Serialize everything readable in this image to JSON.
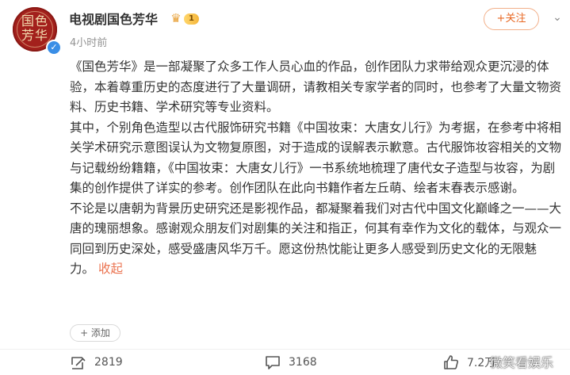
{
  "account": {
    "name": "电视剧国色芳华",
    "avatar_text": "国色芳华",
    "level": "1",
    "verified_icon": "verified-icon",
    "timestamp": "4小时前",
    "follow_label": "+关注"
  },
  "post": {
    "paragraphs": [
      "《国色芳华》是一部凝聚了众多工作人员心血的作品，创作团队力求带给观众更沉浸的体验，本着尊重历史的态度进行了大量调研，请教相关专家学者的同时，也参考了大量文物资料、历史书籍、学术研究等专业资料。",
      "其中，个别角色造型以古代服饰研究书籍《中国妆束：大唐女儿行》为考据，在参考中将相关学术研究示意图误认为文物复原图，对于造成的误解表示歉意。古代服饰妆容相关的文物与记载纷纷籍籍，《中国妆束：大唐女儿行》一书系统地梳理了唐代女子造型与妆容，为剧集的创作提供了详实的参考。创作团队在此向书籍作者左丘萌、绘者末春表示感谢。"
    ],
    "last_paragraph": "不论是以唐朝为背景历史研究还是影视作品，都凝聚着我们对古代中国文化巅峰之一——大唐的瑰丽想象。感谢观众朋友们对剧集的关注和指正，何其有幸作为文化的载体，与观众一同回到历史深处，感受盛唐风华万千。愿这份热忱能让更多人感受到历史文化的无限魅力。",
    "collapse_label": "收起",
    "add_label": "+ 添加"
  },
  "actions": {
    "repost_count": "2819",
    "comment_count": "3168",
    "like_count": "7.2万"
  },
  "watermark": "微笑看娱乐",
  "colors": {
    "accent": "#eb7350",
    "avatar_red": "#a3201c",
    "verified_blue": "#3a8ee6",
    "muted_text": "#939393"
  }
}
